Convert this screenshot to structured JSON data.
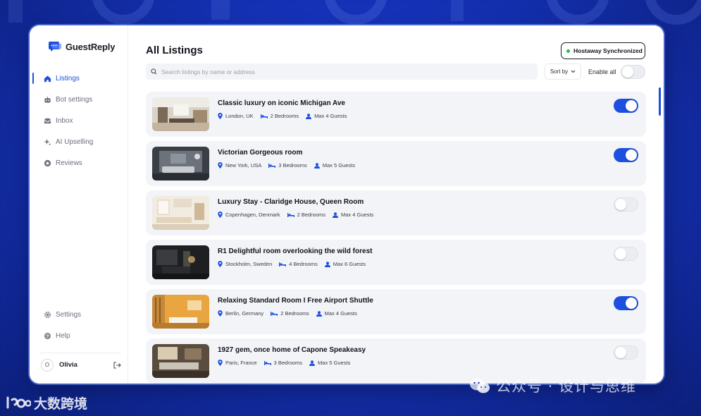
{
  "app": {
    "name": "GuestReply",
    "accent": "#1d4fe0",
    "background": "#1532b8"
  },
  "sidebar": {
    "items": [
      {
        "label": "Listings",
        "icon": "home-icon",
        "active": true
      },
      {
        "label": "Bot settings",
        "icon": "robot-icon",
        "active": false
      },
      {
        "label": "Inbox",
        "icon": "inbox-icon",
        "active": false
      },
      {
        "label": "AI Upselling",
        "icon": "sparkle-icon",
        "active": false
      },
      {
        "label": "Reviews",
        "icon": "star-icon",
        "active": false
      }
    ],
    "bottom_items": [
      {
        "label": "Settings",
        "icon": "gear-icon"
      },
      {
        "label": "Help",
        "icon": "help-icon"
      }
    ],
    "user": {
      "initial": "O",
      "name": "Olivia"
    }
  },
  "header": {
    "title": "All Listings",
    "sync_status": "Hostaway Synchronized",
    "sync_color": "#1fbf4a"
  },
  "search": {
    "placeholder": "Search listings by name or address",
    "value": ""
  },
  "controls": {
    "sort_label": "Sort by",
    "enable_all_label": "Enable all",
    "enable_all_on": false
  },
  "listings": [
    {
      "title": "Classic luxury on iconic Michigan Ave",
      "location": "London, UK",
      "bedrooms": "2 Bedrooms",
      "guests": "Max 4 Guests",
      "enabled": true
    },
    {
      "title": "Victorian Gorgeous room",
      "location": "New York, USA",
      "bedrooms": "3 Bedrooms",
      "guests": "Max 5 Guests",
      "enabled": true
    },
    {
      "title": "Luxury Stay - Claridge House, Queen Room",
      "location": "Copenhagen, Denmark",
      "bedrooms": "2 Bedrooms",
      "guests": "Max 4 Guests",
      "enabled": false
    },
    {
      "title": "R1 Delightful room overlooking the wild forest",
      "location": "Stockholm, Sweden",
      "bedrooms": "4 Bedrooms",
      "guests": "Max 6 Guests",
      "enabled": false
    },
    {
      "title": "Relaxing Standard Room I Free Airport Shuttle",
      "location": "Berlin, Germany",
      "bedrooms": "2 Bedrooms",
      "guests": "Max 4 Guests",
      "enabled": true
    },
    {
      "title": "1927 gem, once home of Capone Speakeasy",
      "location": "Paris, France",
      "bedrooms": "3 Bedrooms",
      "guests": "Max 5 Guests",
      "enabled": false
    }
  ],
  "watermarks": {
    "right": "公众号 · 设计与思维",
    "left": "大数跨境"
  }
}
